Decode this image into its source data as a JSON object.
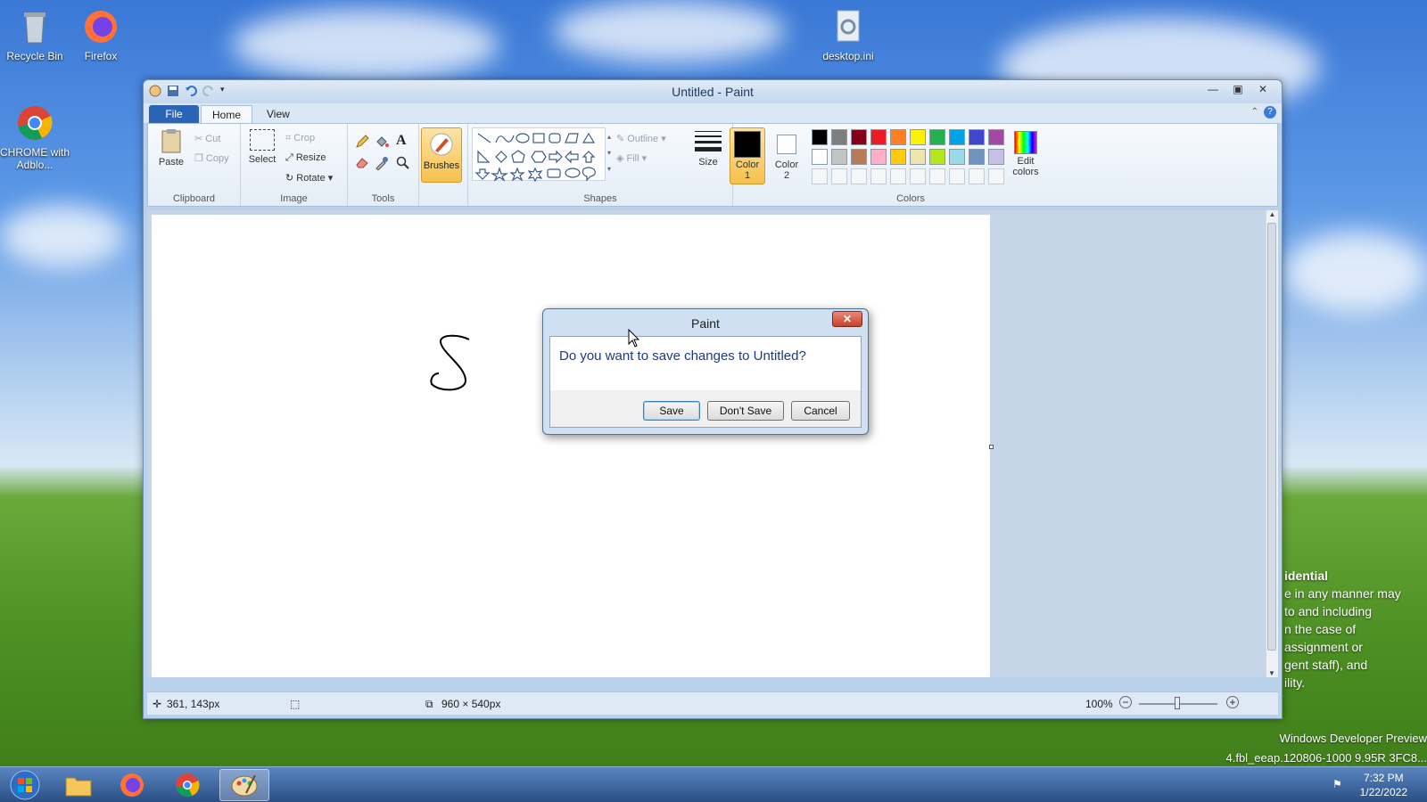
{
  "desktop": {
    "icons": [
      {
        "label": "Recycle Bin",
        "icon": "recycle-bin-icon"
      },
      {
        "label": "Firefox",
        "icon": "firefox-icon"
      },
      {
        "label": "desktop.ini",
        "icon": "settings-file-icon"
      },
      {
        "label": "CHROME with Adblo...",
        "icon": "chrome-icon"
      }
    ],
    "watermark_lines": [
      "idential",
      "e in any manner may",
      "to and including",
      "n the case of",
      "assignment or",
      "gent staff), and",
      "ility."
    ],
    "build_lines": [
      "Windows Developer Preview",
      "4.fbl_eeap.120806-1000 9.95R 3FC8..."
    ]
  },
  "paint": {
    "title": "Untitled - Paint",
    "tabs": [
      "File",
      "Home",
      "View"
    ],
    "clipboard": {
      "paste": "Paste",
      "cut": "Cut",
      "copy": "Copy",
      "label": "Clipboard"
    },
    "image": {
      "select": "Select",
      "crop": "Crop",
      "resize": "Resize",
      "rotate": "Rotate",
      "label": "Image"
    },
    "tools_label": "Tools",
    "brushes": "Brushes",
    "shapes": {
      "outline": "Outline",
      "fill": "Fill",
      "label": "Shapes"
    },
    "size": "Size",
    "color1": "Color 1",
    "color2": "Color 2",
    "colors_label": "Colors",
    "edit_colors": "Edit colors",
    "palette_row1": [
      "#000000",
      "#7f7f7f",
      "#880015",
      "#ed1c24",
      "#ff7f27",
      "#fff200",
      "#22b14c",
      "#00a2e8",
      "#3f48cc",
      "#a349a4"
    ],
    "palette_row2": [
      "#ffffff",
      "#c3c3c3",
      "#b97a57",
      "#ffaec9",
      "#ffc90e",
      "#efe4b0",
      "#b5e61d",
      "#99d9ea",
      "#7092be",
      "#c8bfe7"
    ],
    "status": {
      "position": "361, 143px",
      "canvas_size": "960 × 540px",
      "zoom": "100%"
    }
  },
  "dialog": {
    "title": "Paint",
    "message": "Do you want to save changes to Untitled?",
    "save": "Save",
    "dont_save": "Don't Save",
    "cancel": "Cancel"
  },
  "taskbar": {
    "time": "7:32 PM",
    "date": "1/22/2022"
  }
}
